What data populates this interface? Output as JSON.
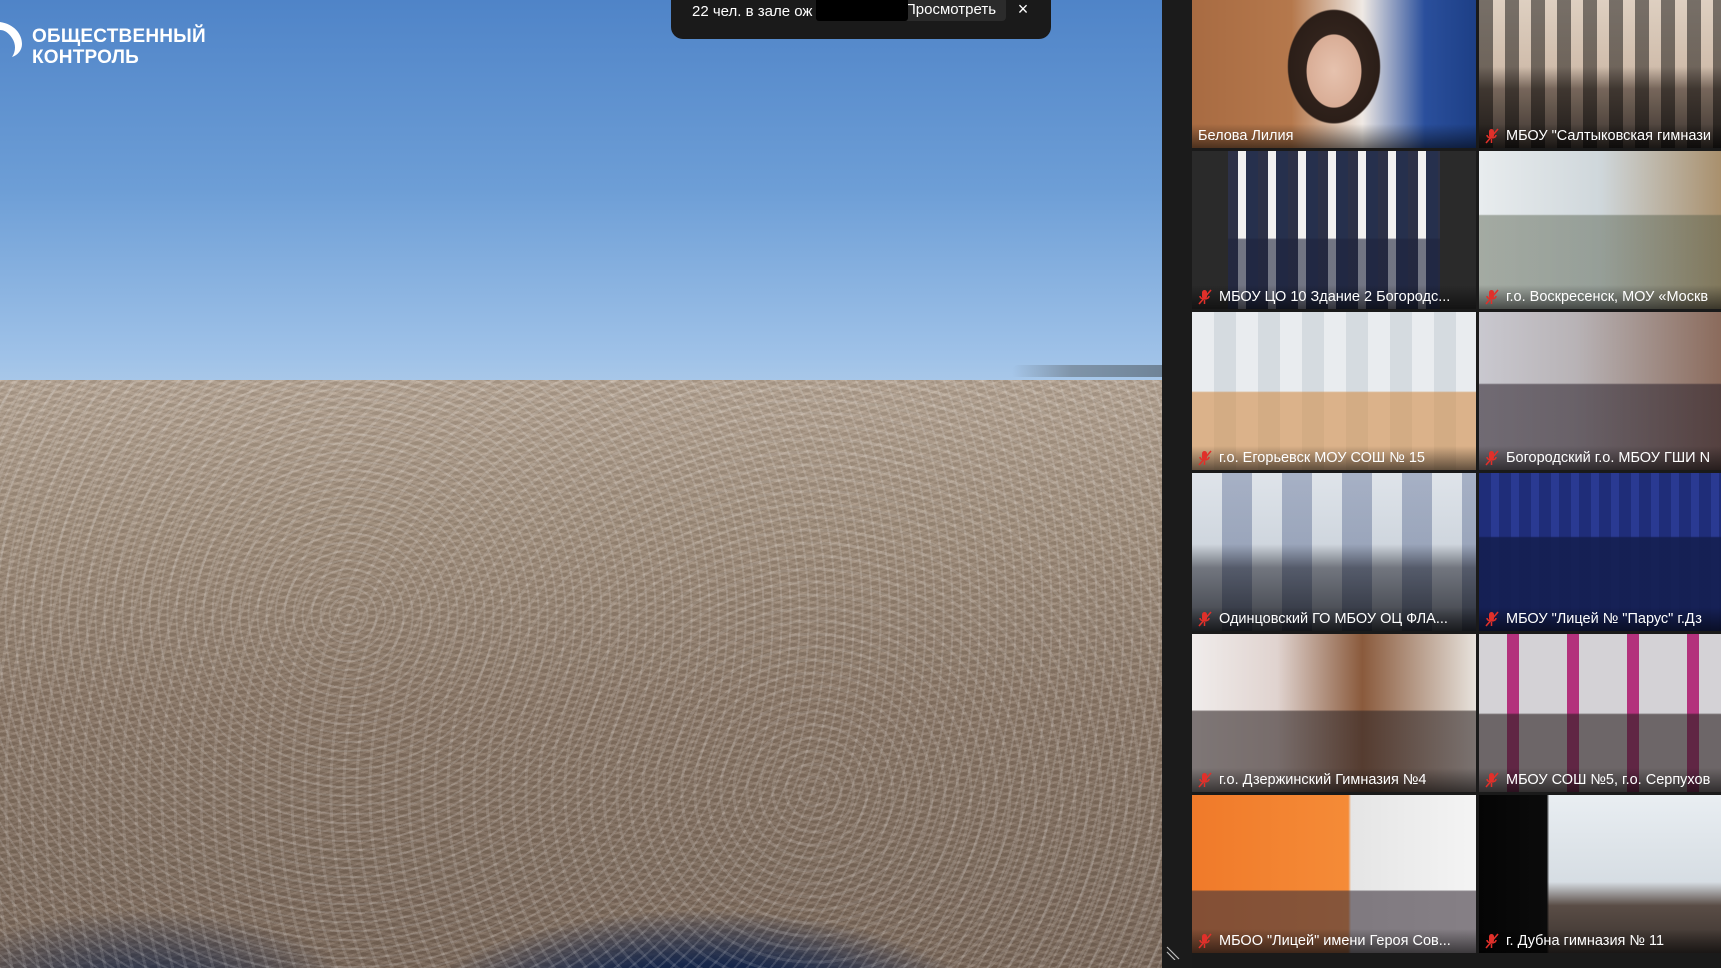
{
  "shared_screen": {
    "logo": {
      "line1": "ОБЩЕСТВЕННЫЙ",
      "line2": "КОНТРОЛЬ"
    }
  },
  "notification": {
    "text": "22 чел. в зале ож",
    "view_label": "Просмотреть",
    "close_label": "×"
  },
  "gallery": {
    "participants": [
      {
        "name": "Белова Лилия",
        "muted": false,
        "active": true
      },
      {
        "name": "МБОУ \"Салтыковская гимнази",
        "muted": true,
        "active": false
      },
      {
        "name": "МБОУ ЦО 10 Здание 2 Богородс...",
        "muted": true,
        "active": false
      },
      {
        "name": "г.о. Воскресенск, МОУ «Москв",
        "muted": true,
        "active": false
      },
      {
        "name": "г.о. Егорьевск МОУ СОШ № 15",
        "muted": true,
        "active": false
      },
      {
        "name": "Богородский г.о. МБОУ ГШИ N",
        "muted": true,
        "active": false
      },
      {
        "name": "Одинцовский ГО МБОУ ОЦ ФЛА...",
        "muted": true,
        "active": false
      },
      {
        "name": "МБОУ \"Лицей № \"Парус\" г.Дз",
        "muted": true,
        "active": false
      },
      {
        "name": "г.о. Дзержинский Гимназия №4",
        "muted": true,
        "active": false
      },
      {
        "name": "МБОУ СОШ №5, г.о. Серпухов",
        "muted": true,
        "active": false
      },
      {
        "name": "МБОО \"Лицей\" имени Героя Сов...",
        "muted": true,
        "active": false
      },
      {
        "name": "г. Дубна гимназия № 11",
        "muted": true,
        "active": false
      }
    ]
  },
  "colors": {
    "active_speaker_outline": "#c3e05a",
    "muted_mic": "#e0302a",
    "panel_bg": "#1a1a1a"
  }
}
